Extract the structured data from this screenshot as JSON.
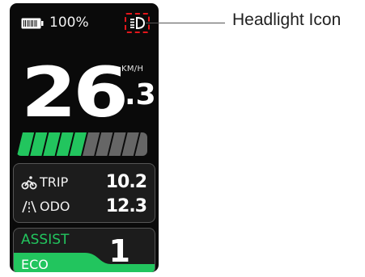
{
  "status": {
    "battery_percent_text": "100%",
    "battery_level": 1.0,
    "battery_icon": "battery-full-icon",
    "headlight_icon": "headlight-icon",
    "headlight_on": true
  },
  "speed": {
    "integer": "26",
    "decimal": ".3",
    "unit": "KM/H"
  },
  "assist_bar": {
    "total_segments": 10,
    "active_segments": 5,
    "active_color": "#22c55e",
    "inactive_color": "#666666"
  },
  "trip_panel": {
    "trip": {
      "icon": "bicycle-icon",
      "label": "TRIP",
      "value": "10.2"
    },
    "odo": {
      "icon": "road-icon",
      "label": "ODO",
      "value": "12.3"
    }
  },
  "assist": {
    "label": "ASSIST",
    "mode": "ECO",
    "level": "1",
    "accent": "#22c55e"
  },
  "callout": {
    "label": "Headlight Icon",
    "highlight_color": "#e3161b"
  }
}
